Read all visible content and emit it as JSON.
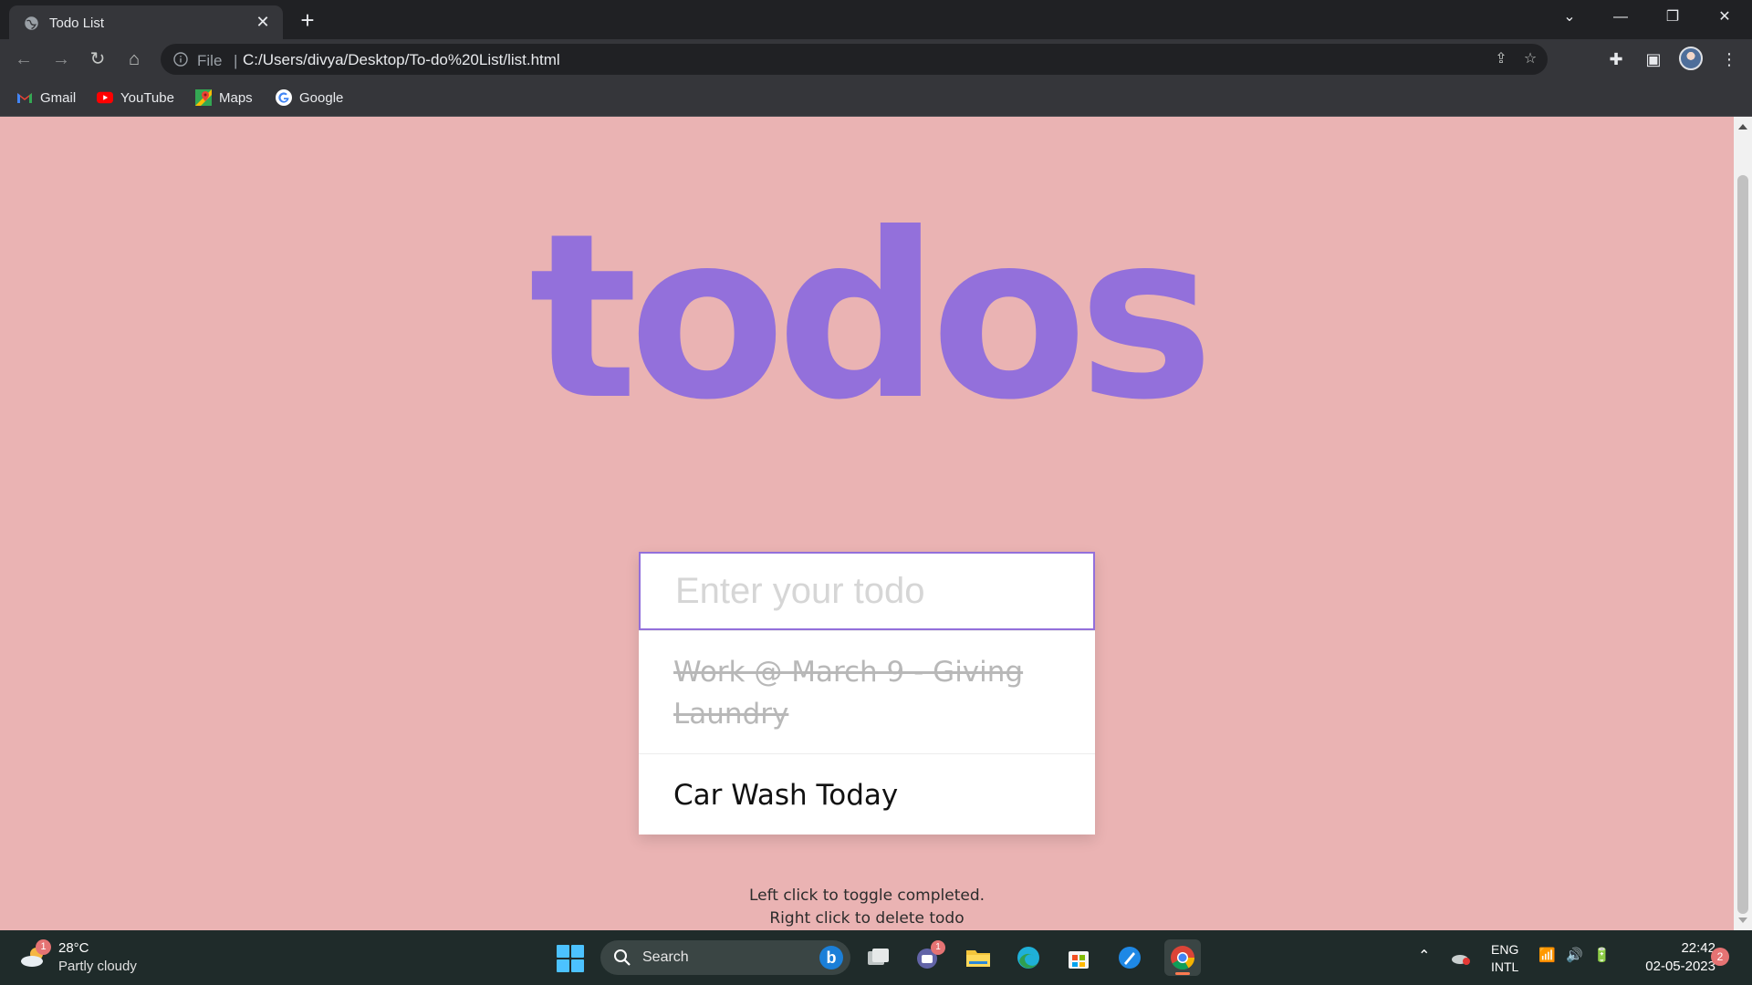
{
  "browser": {
    "tab": {
      "title": "Todo List"
    },
    "address": {
      "scheme": "File",
      "url": "C:/Users/divya/Desktop/To-do%20List/list.html"
    },
    "bookmarks": [
      {
        "label": "Gmail",
        "icon": "gmail-icon"
      },
      {
        "label": "YouTube",
        "icon": "youtube-icon"
      },
      {
        "label": "Maps",
        "icon": "maps-icon"
      },
      {
        "label": "Google",
        "icon": "google-icon"
      }
    ]
  },
  "page": {
    "heading": "todos",
    "input": {
      "placeholder": "Enter your todo",
      "value": ""
    },
    "todos": [
      {
        "text": "Work @ March 9 - Giving Laundry",
        "completed": true
      },
      {
        "text": "Car Wash Today",
        "completed": false
      }
    ],
    "hints": {
      "toggle": "Left click to toggle completed.",
      "delete": "Right click to delete todo"
    },
    "colors": {
      "background": "#eab3b3",
      "accent": "#9370db"
    }
  },
  "taskbar": {
    "weather": {
      "temp": "28°C",
      "desc": "Partly cloudy",
      "badge": "1"
    },
    "search_label": "Search",
    "teams_badge": "1",
    "lang": {
      "line1": "ENG",
      "line2": "INTL"
    },
    "clock": {
      "time": "22:42",
      "date": "02-05-2023"
    },
    "notifications": "2"
  }
}
